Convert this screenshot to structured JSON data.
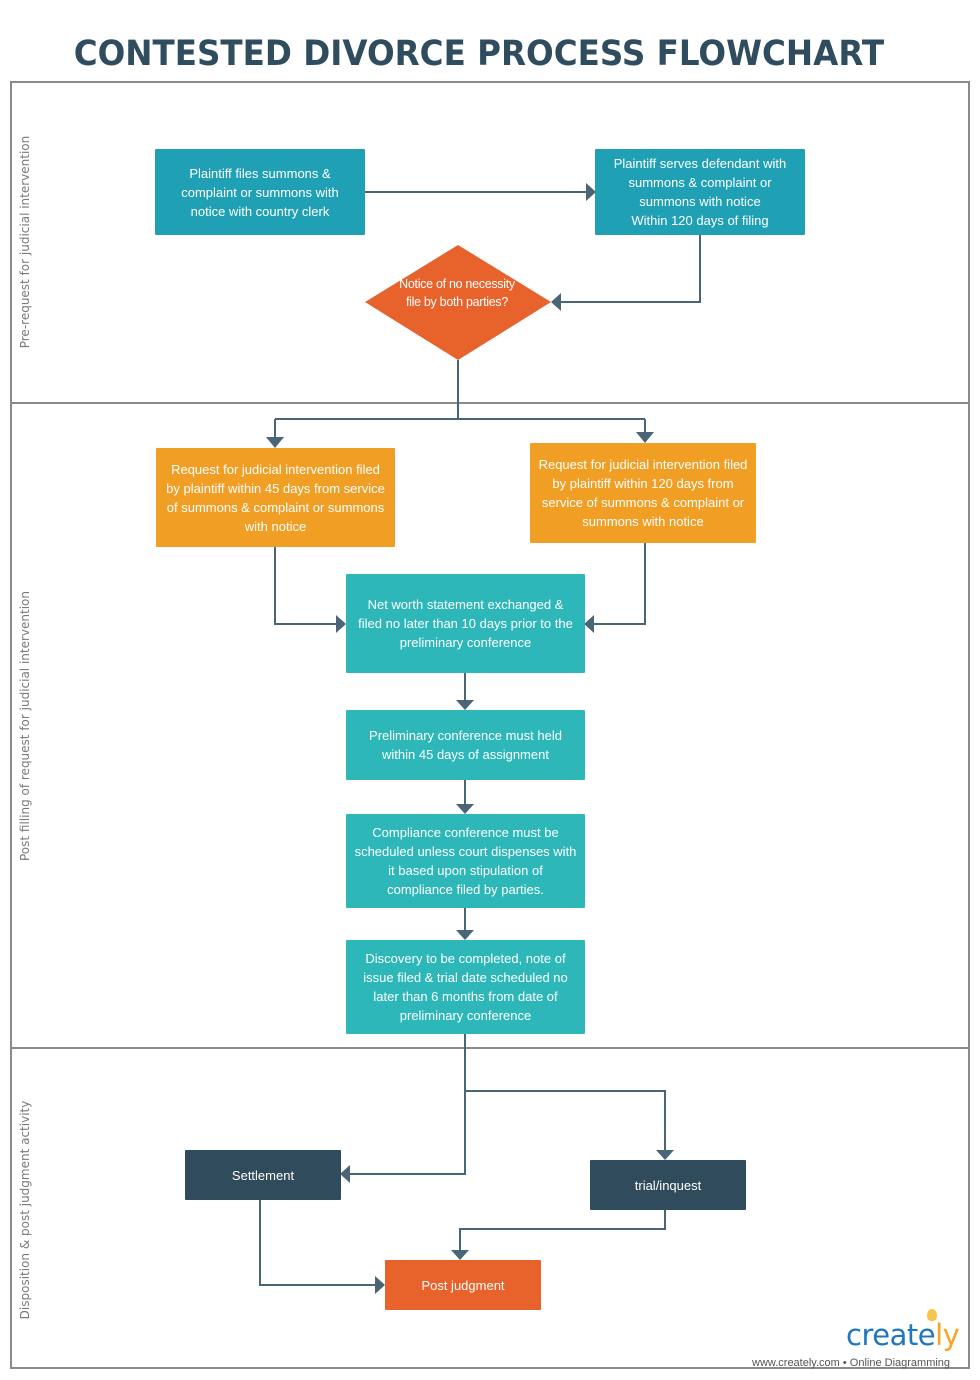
{
  "title": "CONTESTED DIVORCE PROCESS FLOWCHART",
  "colors": {
    "title": "#2f4d5e",
    "lane_border": "#8a8a8a",
    "connector": "#4a6575",
    "teal_dark": "#20a0b4",
    "teal": "#2db7b8",
    "orange": "#f19e25",
    "navy": "#2f4b5c",
    "decision": "#e8622b"
  },
  "lanes": [
    {
      "label": "Pre-request for judicial intervention"
    },
    {
      "label": "Post filling of request for judicial intervention"
    },
    {
      "label": "Disposition & post judgment activity"
    }
  ],
  "nodes": {
    "file_summons": "Plaintiff files summons & complaint or summons with notice with country clerk",
    "serve_defendant": "Plaintiff serves defendant with summons & complaint or summons with notice\nWithin 120 days of filing",
    "decision_notice": "Notice of no necessity file  by both parties?",
    "rji_45": "Request for judicial intervention filed by plaintiff within 45 days from service of summons & complaint or summons with notice",
    "rji_120": "Request for judicial intervention filed by plaintiff within 120 days from service of summons & complaint or summons with notice",
    "net_worth": "Net worth statement exchanged & filed no later than 10 days prior to the preliminary conference",
    "preliminary": "Preliminary conference must held within 45 days of assignment",
    "compliance": "Compliance conference must be scheduled unless court dispenses with it based upon stipulation of compliance filed by parties.",
    "discovery": "Discovery to be completed, note of issue filed & trial date scheduled no later than 6 months from date of preliminary conference",
    "settlement": "Settlement",
    "trial": "trial/inquest",
    "post_judgment": "Post judgment"
  },
  "branding": {
    "logo_main": "create",
    "logo_accent": "ly",
    "tagline": "www.creately.com • Online Diagramming"
  }
}
